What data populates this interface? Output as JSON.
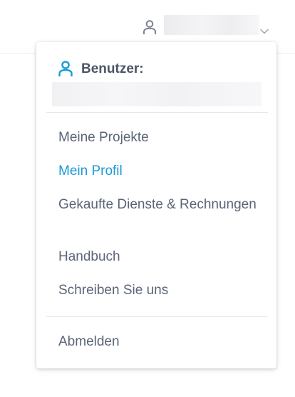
{
  "header": {
    "user_icon": "user-icon",
    "chevron_icon": "chevron-down-icon"
  },
  "dropdown": {
    "user_label": "Benutzer:",
    "user_icon": "user-icon",
    "menu": [
      {
        "label": "Meine Projekte",
        "active": false
      },
      {
        "label": "Mein Profil",
        "active": true
      },
      {
        "label": "Gekaufte Dienste & Rechnungen",
        "active": false
      },
      {
        "label": "Handbuch",
        "active": false
      },
      {
        "label": "Schreiben Sie uns",
        "active": false
      }
    ],
    "logout_label": "Abmelden"
  },
  "colors": {
    "text": "#5a6577",
    "accent": "#1a9ad6",
    "heading": "#4b5666",
    "divider": "#e6e8eb"
  }
}
